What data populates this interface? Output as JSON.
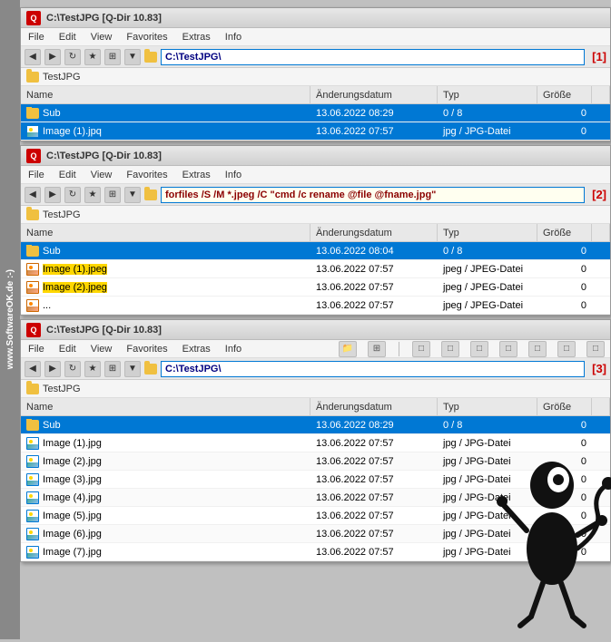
{
  "watermark": {
    "text": "www.SoftwareOK.de :-)"
  },
  "windows": [
    {
      "id": "w1",
      "title": "C:\\TestJPG [Q-Dir 10.83]",
      "menu": [
        "File",
        "Edit",
        "View",
        "Favorites",
        "Extras",
        "Info"
      ],
      "address": "C:\\TestJPG\\",
      "panel_number": "[1]",
      "breadcrumb": "TestJPG",
      "columns": [
        "Name",
        "Änderungsdatum",
        "Typ",
        "Größe"
      ],
      "files": [
        {
          "name": "Sub",
          "type": "folder",
          "date": "13.06.2022 08:29",
          "kind": "0 / 8",
          "size": "0",
          "selected": true
        },
        {
          "name": "Image (1).jpq",
          "type": "image",
          "date": "13.06.2022 07:57",
          "kind": "jpg / JPG-Datei",
          "size": "0",
          "selected": true
        }
      ]
    },
    {
      "id": "w2",
      "title": "C:\\TestJPG [Q-Dir 10.83]",
      "menu": [
        "File",
        "Edit",
        "View",
        "Favorites",
        "Extras",
        "Info"
      ],
      "address": "forfiles /S /M *.jpeg /C \"cmd /c rename @file @fname.jpg\"",
      "panel_number": "[2]",
      "breadcrumb": "TestJPG",
      "columns": [
        "Name",
        "Änderungsdatum",
        "Typ",
        "Größe"
      ],
      "files": [
        {
          "name": "Sub",
          "type": "folder",
          "date": "13.06.2022 08:04",
          "kind": "0 / 8",
          "size": "0",
          "selected": true
        },
        {
          "name": "Image (1).jpeg",
          "type": "jpeg",
          "date": "13.06.2022 07:57",
          "kind": "jpeg / JPEG-Datei",
          "size": "0",
          "selected": false,
          "highlighted": true
        },
        {
          "name": "Image (2).jpeg",
          "type": "jpeg",
          "date": "13.06.2022 07:57",
          "kind": "jpeg / JPEG-Datei",
          "size": "0",
          "selected": false,
          "highlighted": true
        },
        {
          "name": "...",
          "type": "jpeg",
          "date": "13.06.2022 07:57",
          "kind": "jpeg / JPEG-Datei",
          "size": "0",
          "selected": false
        }
      ]
    },
    {
      "id": "w3",
      "title": "C:\\TestJPG [Q-Dir 10.83]",
      "menu": [
        "File",
        "Edit",
        "View",
        "Favorites",
        "Extras",
        "Info"
      ],
      "address": "C:\\TestJPG\\",
      "panel_number": "[3]",
      "breadcrumb": "TestJPG",
      "columns": [
        "Name",
        "Änderungsdatum",
        "Typ",
        "Größe"
      ],
      "files": [
        {
          "name": "Sub",
          "type": "folder",
          "date": "13.06.2022 08:29",
          "kind": "0 / 8",
          "size": "0",
          "selected": true
        },
        {
          "name": "Image (1).jpg",
          "type": "image",
          "date": "13.06.2022 07:57",
          "kind": "jpg / JPG-Datei",
          "size": "0",
          "selected": false
        },
        {
          "name": "Image (2).jpg",
          "type": "image",
          "date": "13.06.2022 07:57",
          "kind": "jpg / JPG-Datei",
          "size": "0",
          "selected": false
        },
        {
          "name": "Image (3).jpg",
          "type": "image",
          "date": "13.06.2022 07:57",
          "kind": "jpg / JPG-Datei",
          "size": "0",
          "selected": false
        },
        {
          "name": "Image (4).jpg",
          "type": "image",
          "date": "13.06.2022 07:57",
          "kind": "jpg / JPG-Datei",
          "size": "0",
          "selected": false
        },
        {
          "name": "Image (5).jpg",
          "type": "image",
          "date": "13.06.2022 07:57",
          "kind": "jpg / JPG-Datei",
          "size": "0",
          "selected": false
        },
        {
          "name": "Image (6).jpg",
          "type": "image",
          "date": "13.06.2022 07:57",
          "kind": "jpg / JPG-Datei",
          "size": "0",
          "selected": false
        },
        {
          "name": "Image (7).jpg",
          "type": "image",
          "date": "13.06.2022 07:57",
          "kind": "jpg / JPG-Datei",
          "size": "0",
          "selected": false
        }
      ]
    }
  ]
}
